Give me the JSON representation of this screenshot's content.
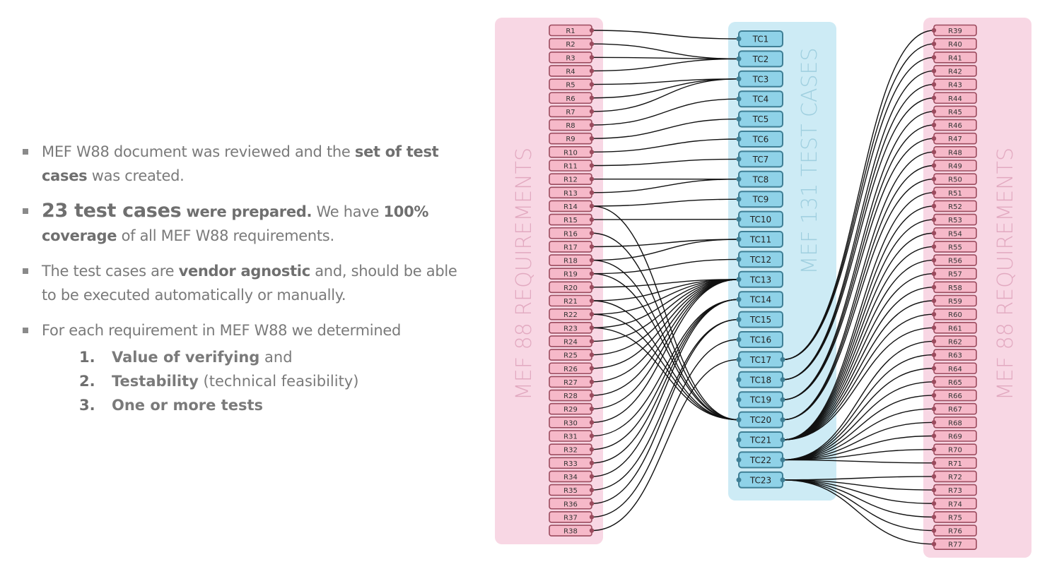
{
  "bullets": [
    {
      "parts": [
        {
          "t": "MEF W88 document was reviewed and the ",
          "b": false
        },
        {
          "t": "set of test cases",
          "b": true
        },
        {
          "t": " was created.",
          "b": false
        }
      ]
    },
    {
      "parts": [
        {
          "t": "23 test cases",
          "b": true,
          "lg": true
        },
        {
          "t": " were prepared.",
          "b": true
        },
        {
          "t": " We have ",
          "b": false
        },
        {
          "t": "100% coverage",
          "b": true
        },
        {
          "t": " of all MEF W88 requirements.",
          "b": false
        }
      ]
    },
    {
      "parts": [
        {
          "t": "The test cases are ",
          "b": false
        },
        {
          "t": "vendor agnostic",
          "b": true
        },
        {
          "t": " and, should be able to be executed automatically or manually.",
          "b": false
        }
      ]
    },
    {
      "parts": [
        {
          "t": "For each requirement in MEF W88 we determined",
          "b": false
        }
      ]
    }
  ],
  "numbered": [
    {
      "num": "1.",
      "bold": "Value of verifying",
      "rest": " and"
    },
    {
      "num": "2.",
      "bold": "Testability",
      "rest": " (technical feasibility)"
    },
    {
      "num": "3.",
      "bold": "One or more tests",
      "rest": ""
    }
  ],
  "diagram": {
    "left_group_label": "MEF 88 REQUIREMENTS",
    "middle_group_label": "MEF 131 TEST CASES",
    "right_group_label": "MEF 88 REQUIREMENTS",
    "colors": {
      "req_fill": "#f6b9c9",
      "req_stroke": "#9b4b5e",
      "req_group_bg": "#f8d7e4",
      "req_group_text": "#e2a9c0",
      "tc_fill": "#8fd2e8",
      "tc_stroke": "#3f7f95",
      "tc_group_bg": "#cdebf5",
      "tc_group_text": "#9fcfdf",
      "link": "#111111"
    },
    "left_requirements": [
      "R1",
      "R2",
      "R3",
      "R4",
      "R5",
      "R6",
      "R7",
      "R8",
      "R9",
      "R10",
      "R11",
      "R12",
      "R13",
      "R14",
      "R15",
      "R16",
      "R17",
      "R18",
      "R19",
      "R20",
      "R21",
      "R22",
      "R23",
      "R24",
      "R25",
      "R26",
      "R27",
      "R28",
      "R29",
      "R30",
      "R31",
      "R32",
      "R33",
      "R34",
      "R35",
      "R36",
      "R37",
      "R38"
    ],
    "test_cases": [
      "TC1",
      "TC2",
      "TC3",
      "TC4",
      "TC5",
      "TC6",
      "TC7",
      "TC8",
      "TC9",
      "TC10",
      "TC11",
      "TC12",
      "TC13",
      "TC14",
      "TC15",
      "TC16",
      "TC17",
      "TC18",
      "TC19",
      "TC20",
      "TC21",
      "TC22",
      "TC23"
    ],
    "right_requirements": [
      "R39",
      "R40",
      "R41",
      "R42",
      "R43",
      "R44",
      "R45",
      "R46",
      "R47",
      "R48",
      "R49",
      "R50",
      "R51",
      "R52",
      "R53",
      "R54",
      "R55",
      "R56",
      "R57",
      "R58",
      "R59",
      "R60",
      "R61",
      "R62",
      "R63",
      "R64",
      "R65",
      "R66",
      "R67",
      "R68",
      "R69",
      "R70",
      "R71",
      "R72",
      "R73",
      "R74",
      "R75",
      "R76",
      "R77"
    ],
    "left_links": [
      [
        "R1",
        "TC1"
      ],
      [
        "R2",
        "TC2"
      ],
      [
        "R3",
        "TC2"
      ],
      [
        "R4",
        "TC2"
      ],
      [
        "R5",
        "TC3"
      ],
      [
        "R6",
        "TC3"
      ],
      [
        "R7",
        "TC3"
      ],
      [
        "R8",
        "TC4"
      ],
      [
        "R9",
        "TC5"
      ],
      [
        "R10",
        "TC6"
      ],
      [
        "R11",
        "TC7"
      ],
      [
        "R12",
        "TC8"
      ],
      [
        "R13",
        "TC8"
      ],
      [
        "R14",
        "TC9"
      ],
      [
        "R14",
        "TC20"
      ],
      [
        "R15",
        "TC10"
      ],
      [
        "R16",
        "TC20"
      ],
      [
        "R17",
        "TC11"
      ],
      [
        "R18",
        "TC11"
      ],
      [
        "R18",
        "TC20"
      ],
      [
        "R19",
        "TC12"
      ],
      [
        "R19",
        "TC20"
      ],
      [
        "R20",
        "TC13"
      ],
      [
        "R21",
        "TC13"
      ],
      [
        "R21",
        "TC20"
      ],
      [
        "R22",
        "TC13"
      ],
      [
        "R22",
        "TC20"
      ],
      [
        "R23",
        "TC13"
      ],
      [
        "R23",
        "TC20"
      ],
      [
        "R24",
        "TC13"
      ],
      [
        "R25",
        "TC13"
      ],
      [
        "R26",
        "TC13"
      ],
      [
        "R27",
        "TC13"
      ],
      [
        "R28",
        "TC13"
      ],
      [
        "R29",
        "TC13"
      ],
      [
        "R30",
        "TC13"
      ],
      [
        "R31",
        "TC14"
      ],
      [
        "R32",
        "TC14"
      ],
      [
        "R33",
        "TC14"
      ],
      [
        "R34",
        "TC14"
      ],
      [
        "R35",
        "TC15"
      ],
      [
        "R36",
        "TC15"
      ],
      [
        "R37",
        "TC16"
      ],
      [
        "R38",
        "TC17"
      ]
    ],
    "right_links": [
      [
        "TC17",
        "R39"
      ],
      [
        "TC17",
        "R40"
      ],
      [
        "TC17",
        "R41"
      ],
      [
        "TC18",
        "R42"
      ],
      [
        "TC18",
        "R43"
      ],
      [
        "TC18",
        "R44"
      ],
      [
        "TC19",
        "R45"
      ],
      [
        "TC19",
        "R46"
      ],
      [
        "TC19",
        "R47"
      ],
      [
        "TC20",
        "R48"
      ],
      [
        "TC20",
        "R49"
      ],
      [
        "TC20",
        "R50"
      ],
      [
        "TC21",
        "R51"
      ],
      [
        "TC21",
        "R52"
      ],
      [
        "TC21",
        "R53"
      ],
      [
        "TC21",
        "R54"
      ],
      [
        "TC21",
        "R55"
      ],
      [
        "TC21",
        "R56"
      ],
      [
        "TC21",
        "R57"
      ],
      [
        "TC21",
        "R58"
      ],
      [
        "TC21",
        "R59"
      ],
      [
        "TC21",
        "R60"
      ],
      [
        "TC21",
        "R61"
      ],
      [
        "TC22",
        "R62"
      ],
      [
        "TC22",
        "R63"
      ],
      [
        "TC22",
        "R64"
      ],
      [
        "TC22",
        "R65"
      ],
      [
        "TC22",
        "R66"
      ],
      [
        "TC22",
        "R67"
      ],
      [
        "TC22",
        "R68"
      ],
      [
        "TC22",
        "R69"
      ],
      [
        "TC22",
        "R70"
      ],
      [
        "TC22",
        "R71"
      ],
      [
        "TC23",
        "R72"
      ],
      [
        "TC23",
        "R73"
      ],
      [
        "TC23",
        "R74"
      ],
      [
        "TC23",
        "R75"
      ],
      [
        "TC23",
        "R76"
      ],
      [
        "TC23",
        "R77"
      ]
    ]
  }
}
